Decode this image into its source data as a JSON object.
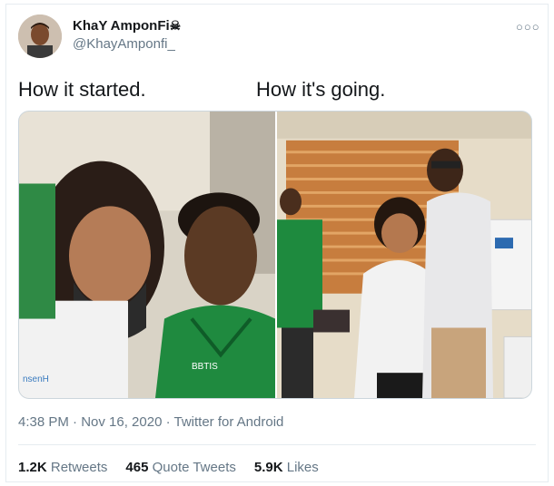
{
  "tweet": {
    "display_name": "KhaY AmponFi",
    "name_emoji": "skull-icon",
    "handle": "@KhayAmponfi_",
    "caption_left": "How it started.",
    "caption_right": "How it's going.",
    "photo_left_text": "BBTIS",
    "photo_left_badge": "nsenH",
    "timestamp": "4:38 PM · Nov 16, 2020 · Twitter for Android",
    "more_icon": "more-options-icon"
  },
  "stats": {
    "retweets_count": "1.2K",
    "retweets_label": "Retweets",
    "quotes_count": "465",
    "quotes_label": "Quote Tweets",
    "likes_count": "5.9K",
    "likes_label": "Likes"
  },
  "colors": {
    "text": "#14171a",
    "secondary": "#657786",
    "border": "#e6ecf0"
  }
}
